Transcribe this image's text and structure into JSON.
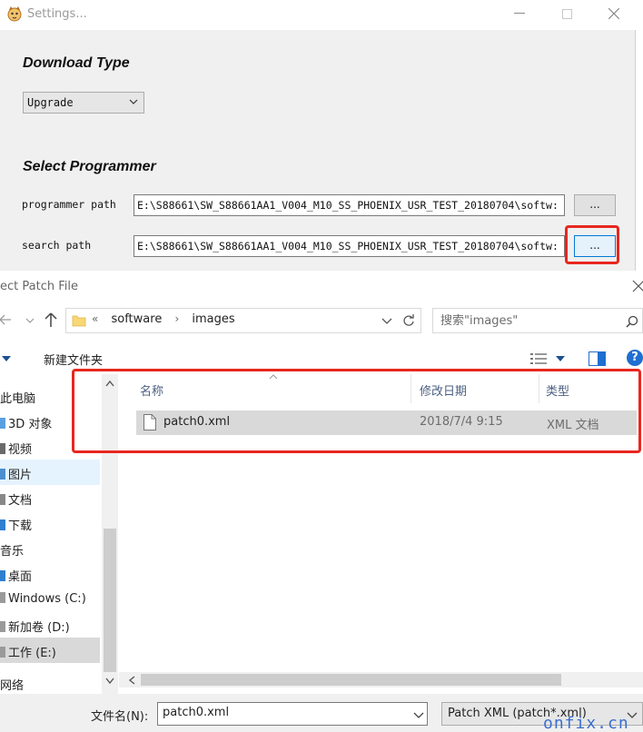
{
  "settings_window": {
    "title": "Settings...",
    "download_type": {
      "heading": "Download Type",
      "selected": "Upgrade"
    },
    "select_programmer": {
      "heading": "Select Programmer",
      "programmer_path_label": "programmer path",
      "programmer_path_value": "E:\\S88661\\SW_S88661AA1_V004_M10_SS_PHOENIX_USR_TEST_20180704\\softw:",
      "search_path_label": "search path",
      "search_path_value": "E:\\S88661\\SW_S88661AA1_V004_M10_SS_PHOENIX_USR_TEST_20180704\\softw:",
      "browse_label": "..."
    }
  },
  "file_dialog": {
    "title": "ect Patch File",
    "breadcrumb": [
      "software",
      "images"
    ],
    "breadcrumb_prefix": "«",
    "search_placeholder": "搜索\"images\"",
    "new_folder": "新建文件夹",
    "help": "?",
    "nav_items": [
      {
        "label": "此电脑"
      },
      {
        "label": "3D 对象"
      },
      {
        "label": "视频"
      },
      {
        "label": "图片"
      },
      {
        "label": "文档"
      },
      {
        "label": "下载"
      },
      {
        "label": "音乐"
      },
      {
        "label": "桌面"
      },
      {
        "label": "Windows (C:)"
      },
      {
        "label": "新加卷 (D:)"
      },
      {
        "label": "工作 (E:)"
      },
      {
        "label": "网络"
      }
    ],
    "columns": {
      "name": "名称",
      "date": "修改日期",
      "type": "类型"
    },
    "files": [
      {
        "name": "patch0.xml",
        "date": "2018/7/4 9:15",
        "type": "XML 文档"
      }
    ],
    "file_name_label": "文件名(N):",
    "file_name_value": "patch0.xml",
    "file_type_value": "Patch XML (patch*.xml)"
  },
  "watermark": "onfix.cn",
  "colors": {
    "highlight_red": "#e8271f",
    "selection_blue": "#e5f3ff",
    "accent_blue": "#0078d7"
  }
}
